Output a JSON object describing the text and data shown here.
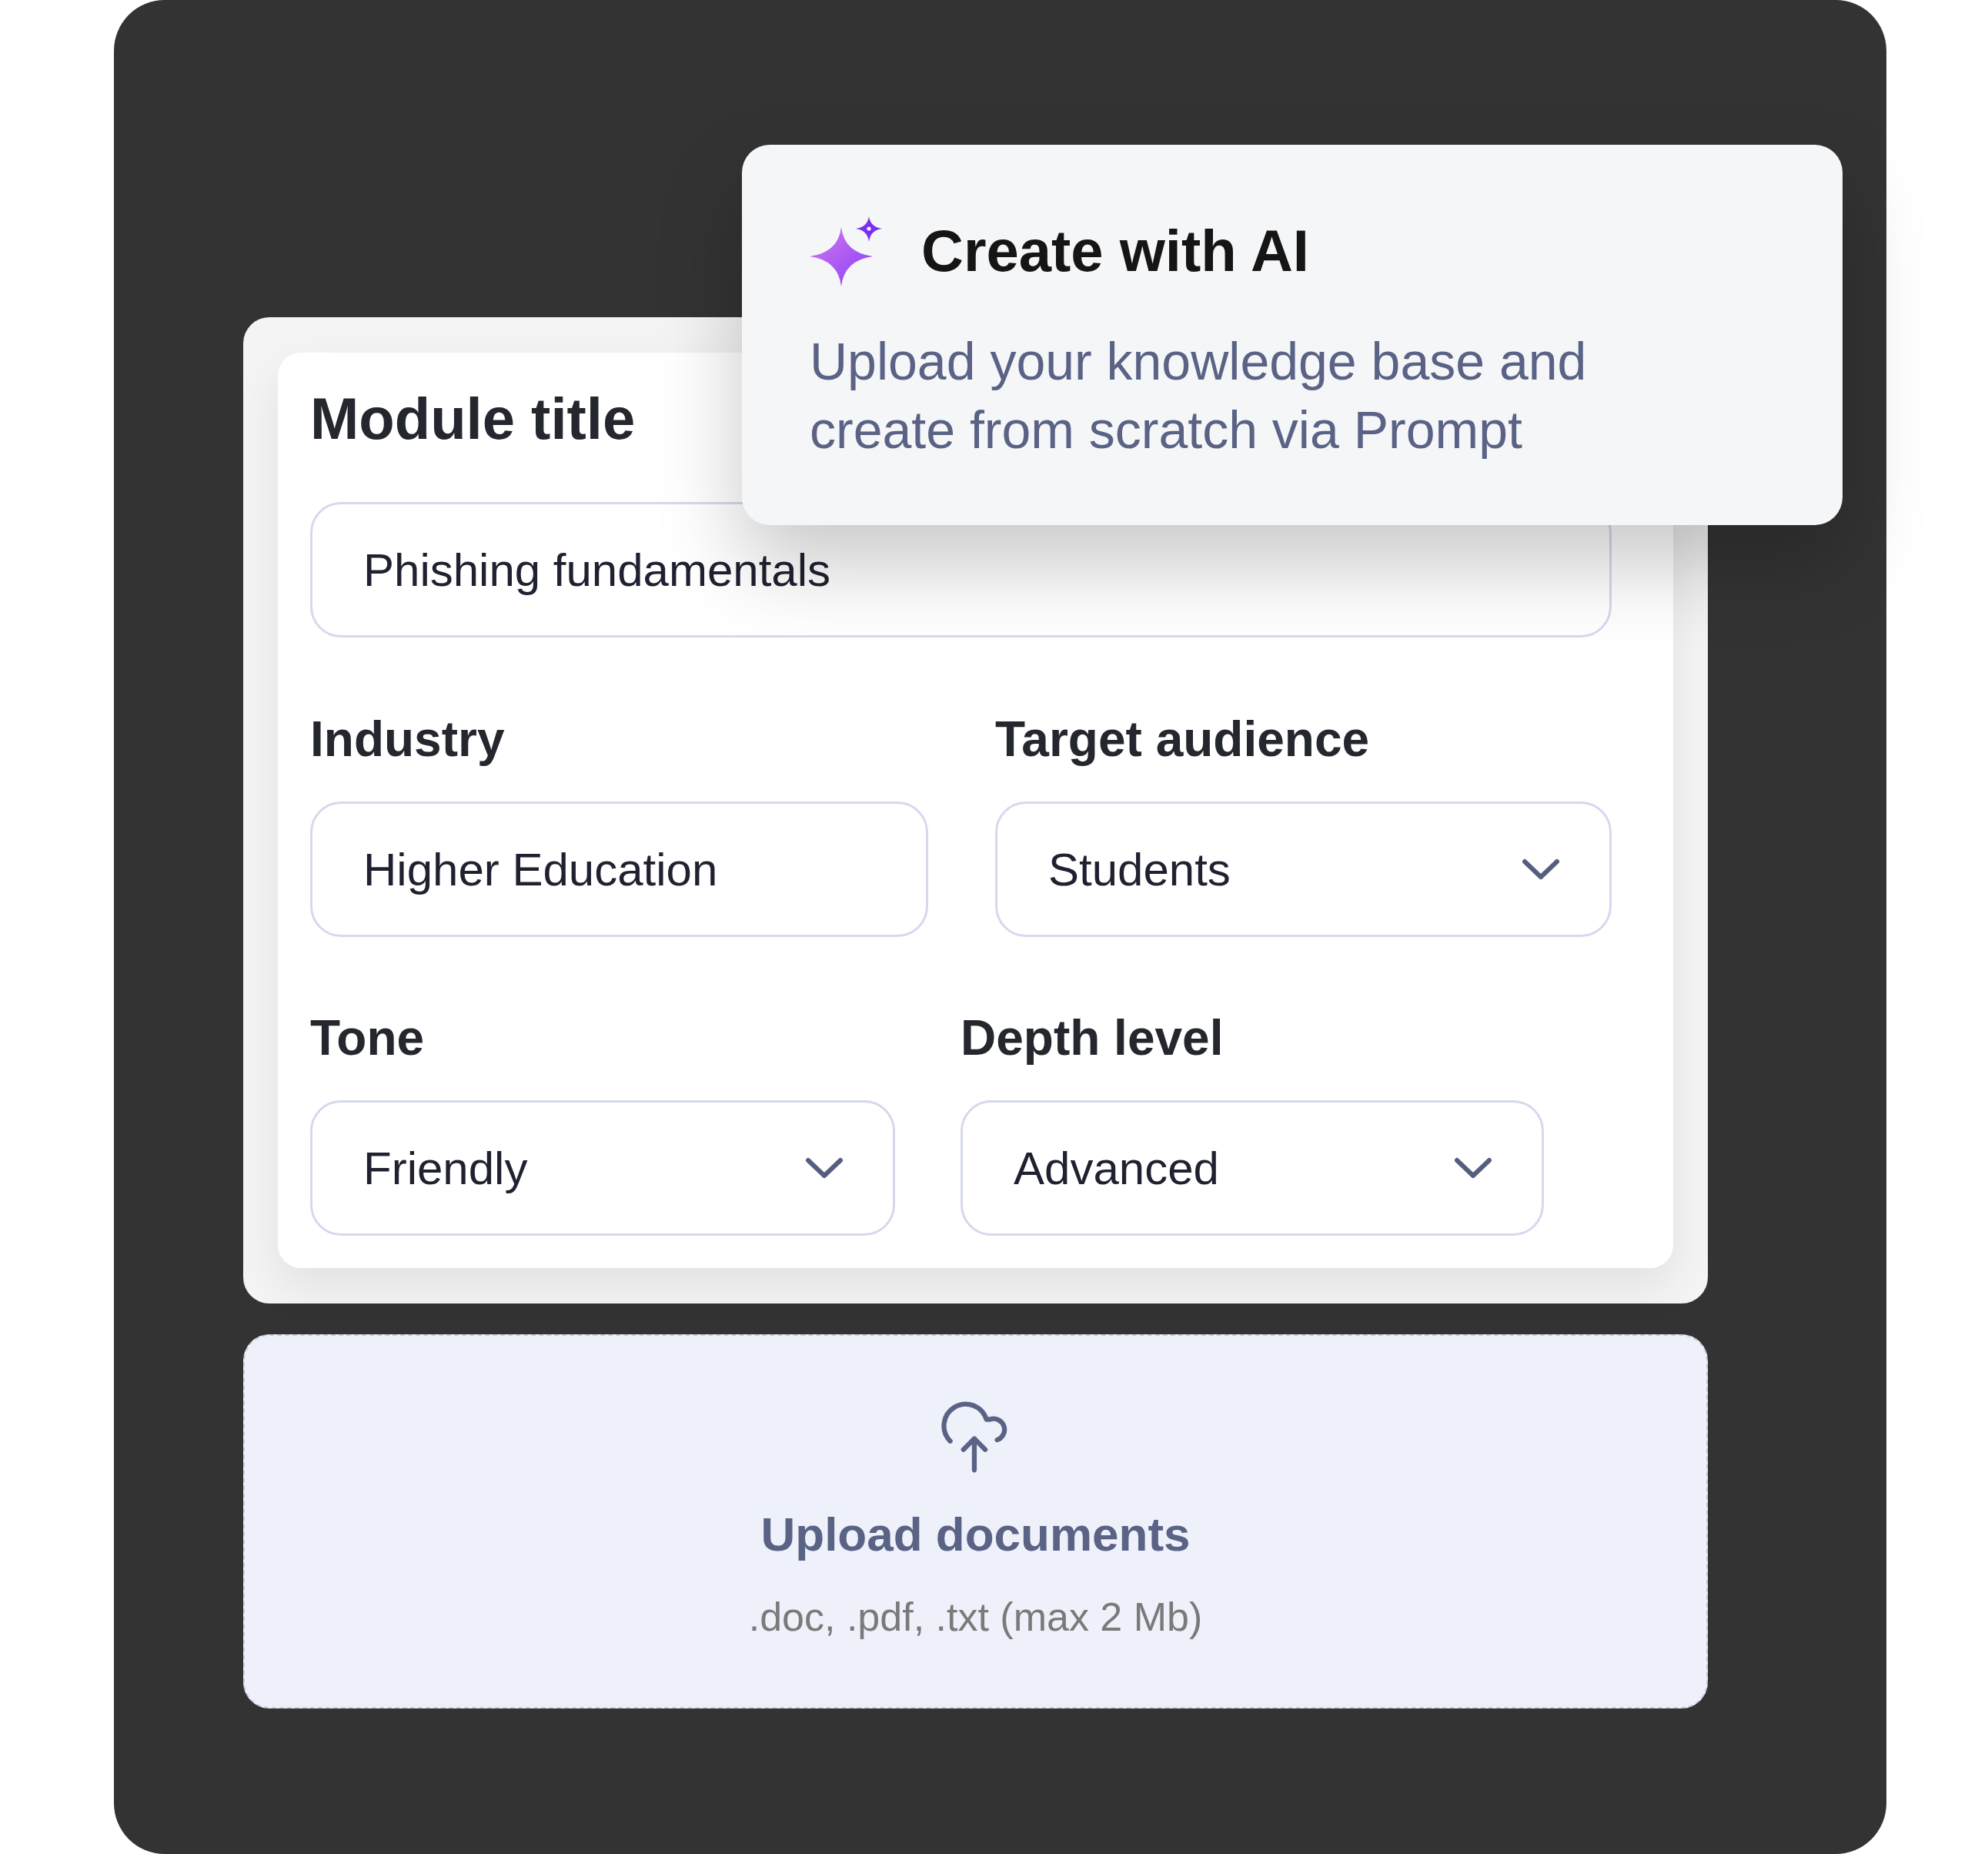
{
  "ai_card": {
    "title": "Create with AI",
    "description": "Upload your knowledge base and create from scratch via Prompt"
  },
  "form": {
    "title_field": {
      "label": "Module title",
      "value": "Phishing fundamentals"
    },
    "rows": [
      [
        {
          "label": "Industry",
          "kind": "text",
          "value": "Higher Education"
        },
        {
          "label": "Target audience",
          "kind": "select",
          "value": "Students"
        }
      ],
      [
        {
          "label": "Tone",
          "kind": "select",
          "value": "Friendly"
        },
        {
          "label": "Depth level",
          "kind": "select",
          "value": "Advanced"
        }
      ]
    ]
  },
  "upload": {
    "title": "Upload documents",
    "hint": ".doc, .pdf, .txt (max 2 Mb)"
  }
}
